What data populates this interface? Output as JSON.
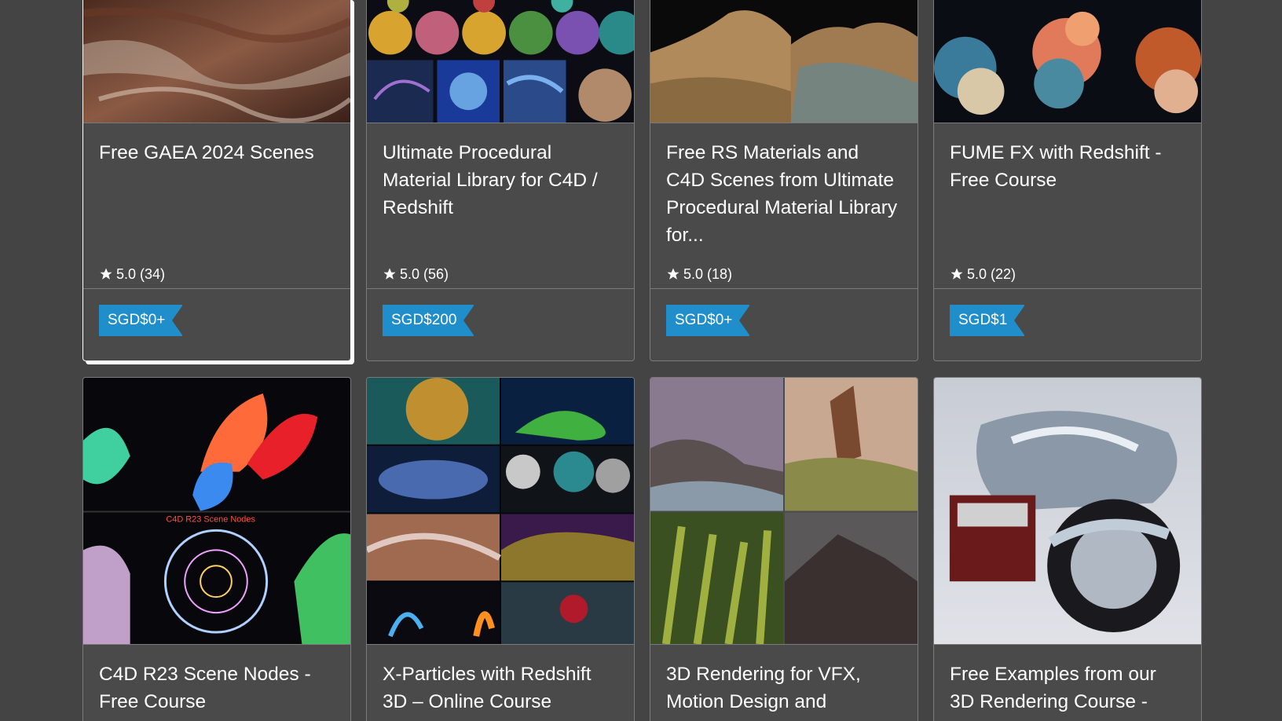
{
  "cards": [
    {
      "title": "Free GAEA 2024 Scenes",
      "rating": "5.0 (34)",
      "price": "SGD$0+"
    },
    {
      "title": "Ultimate Procedural Material Library for C4D / Redshift",
      "rating": "5.0 (56)",
      "price": "SGD$200"
    },
    {
      "title": "Free RS Materials and C4D Scenes from Ultimate Procedural Material Library for...",
      "rating": "5.0 (18)",
      "price": "SGD$0+"
    },
    {
      "title": "FUME FX with Redshift - Free Course",
      "rating": "5.0 (22)",
      "price": "SGD$1"
    },
    {
      "title": "C4D R23 Scene Nodes - Free Course",
      "thumb_caption": "C4D R23 Scene Nodes"
    },
    {
      "title": "X-Particles with Redshift 3D – Online Course"
    },
    {
      "title": "3D Rendering for VFX, Motion Design and"
    },
    {
      "title": "Free Examples from our 3D Rendering Course -"
    }
  ],
  "colors": {
    "background": "#444444",
    "card": "#4a4a4a",
    "price_tag": "#1f8ecb"
  },
  "icons": {
    "rating": "star-icon"
  }
}
